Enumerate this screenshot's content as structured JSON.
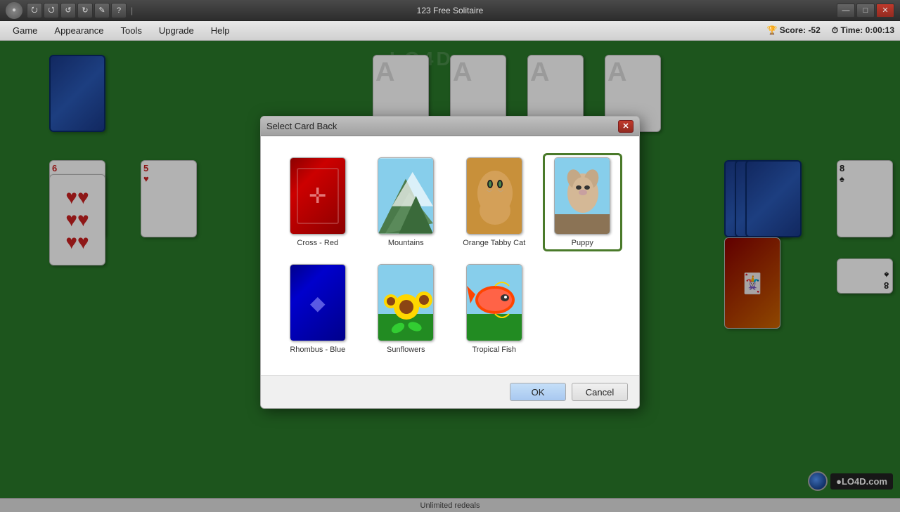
{
  "window": {
    "title": "123 Free Solitaire",
    "controls": {
      "minimize": "—",
      "maximize": "□",
      "close": "✕"
    }
  },
  "titlebar": {
    "toolbar_buttons": [
      "⭮",
      "⭯",
      "↺",
      "↻",
      "✎",
      "?"
    ],
    "separator": "|"
  },
  "menubar": {
    "items": [
      "Game",
      "Appearance",
      "Tools",
      "Upgrade",
      "Help"
    ],
    "score_label": "Score:",
    "score_value": "-52",
    "time_label": "Time:",
    "time_value": "0:00:13"
  },
  "statusbar": {
    "text": "Unlimited redeals"
  },
  "dialog": {
    "title": "Select Card Back",
    "close_btn": "✕",
    "cards": [
      {
        "id": "cross-red",
        "label": "Cross - Red",
        "selected": false
      },
      {
        "id": "mountains",
        "label": "Mountains",
        "selected": false
      },
      {
        "id": "orange-tabby-cat",
        "label": "Orange Tabby Cat",
        "selected": false
      },
      {
        "id": "puppy",
        "label": "Puppy",
        "selected": true
      },
      {
        "id": "rhombus-blue",
        "label": "Rhombus - Blue",
        "selected": false
      },
      {
        "id": "sunflowers",
        "label": "Sunflowers",
        "selected": false
      },
      {
        "id": "tropical-fish",
        "label": "Tropical Fish",
        "selected": false
      }
    ],
    "ok_label": "OK",
    "cancel_label": "Cancel"
  },
  "colors": {
    "green_table": "#2a7a2a",
    "dialog_selected_border": "#4a7a2a",
    "ok_btn_bg": "#c5dff8"
  }
}
